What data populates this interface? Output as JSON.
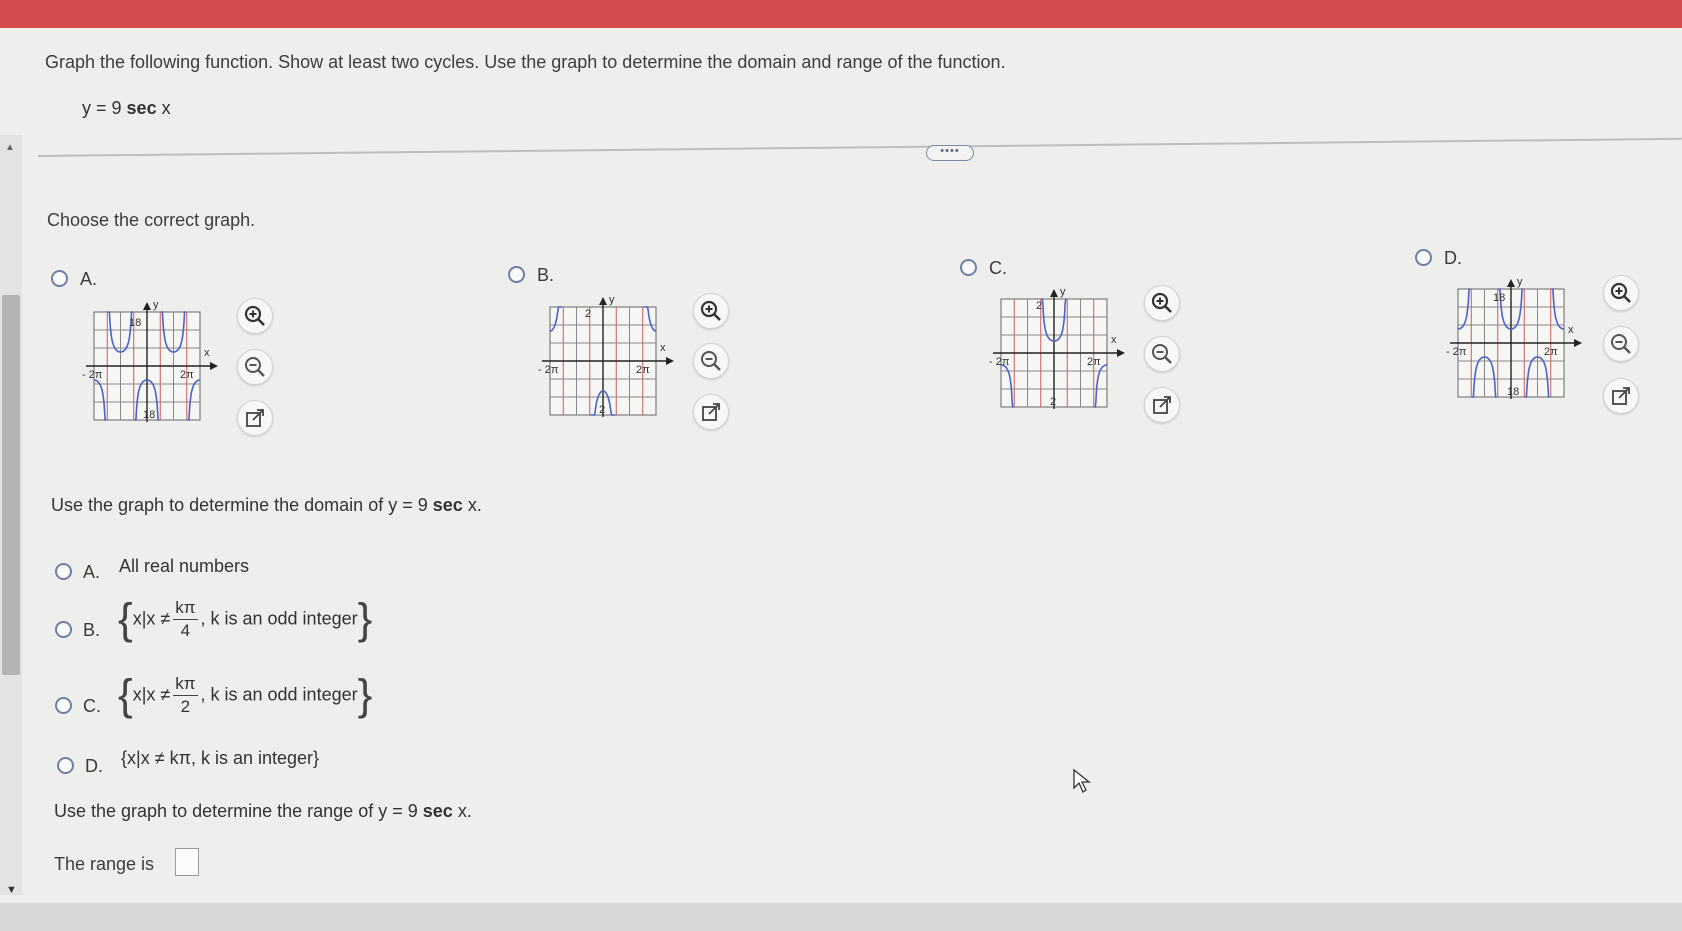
{
  "question": {
    "prompt": "Graph the following function. Show at least two cycles. Use the graph to determine the domain and range of the function.",
    "function_prefix": "y = 9",
    "function_sec": "sec",
    "function_var": "x"
  },
  "expand_label": "••••",
  "choose_graph_label": "Choose the correct graph.",
  "graph_options": [
    {
      "letter": "A.",
      "ymax": "18",
      "ymin": "18",
      "xneg": "- 2π",
      "xpos": "2π"
    },
    {
      "letter": "B.",
      "ymax": "2",
      "ymin": "2",
      "xneg": "- 2π",
      "xpos": "2π"
    },
    {
      "letter": "C.",
      "ymax": "2",
      "ymin": "2",
      "xneg": "- 2π",
      "xpos": "2π"
    },
    {
      "letter": "D.",
      "ymax": "18",
      "ymin": "18",
      "xneg": "- 2π",
      "xpos": "2π"
    }
  ],
  "axis_labels": {
    "x": "x",
    "y": "y"
  },
  "icons": [
    "zoom-in-icon",
    "zoom-out-icon",
    "external-link-icon"
  ],
  "domain_question": {
    "prefix": "Use the graph to determine the domain of y = 9",
    "sec": "sec",
    "suffix": "x."
  },
  "domain_options": [
    {
      "letter": "A.",
      "text": "All real numbers"
    },
    {
      "letter": "B.",
      "set_start": "x|x ≠",
      "num": "kπ",
      "den": "4",
      "tail": ", k is an odd integer"
    },
    {
      "letter": "C.",
      "set_start": "x|x ≠",
      "num": "kπ",
      "den": "2",
      "tail": ", k is an odd integer"
    },
    {
      "letter": "D.",
      "text": "{x|x ≠ kπ, k is an integer}"
    }
  ],
  "range_question": {
    "prefix": "Use the graph to determine the range of y = 9",
    "sec": "sec",
    "suffix": "x."
  },
  "range_answer_label": "The range is",
  "colors": {
    "header_red": "#d64b4e",
    "curve_blue": "#4a63c8",
    "grid_red": "#cc5a5a",
    "radio_border": "#6c7fa6"
  }
}
